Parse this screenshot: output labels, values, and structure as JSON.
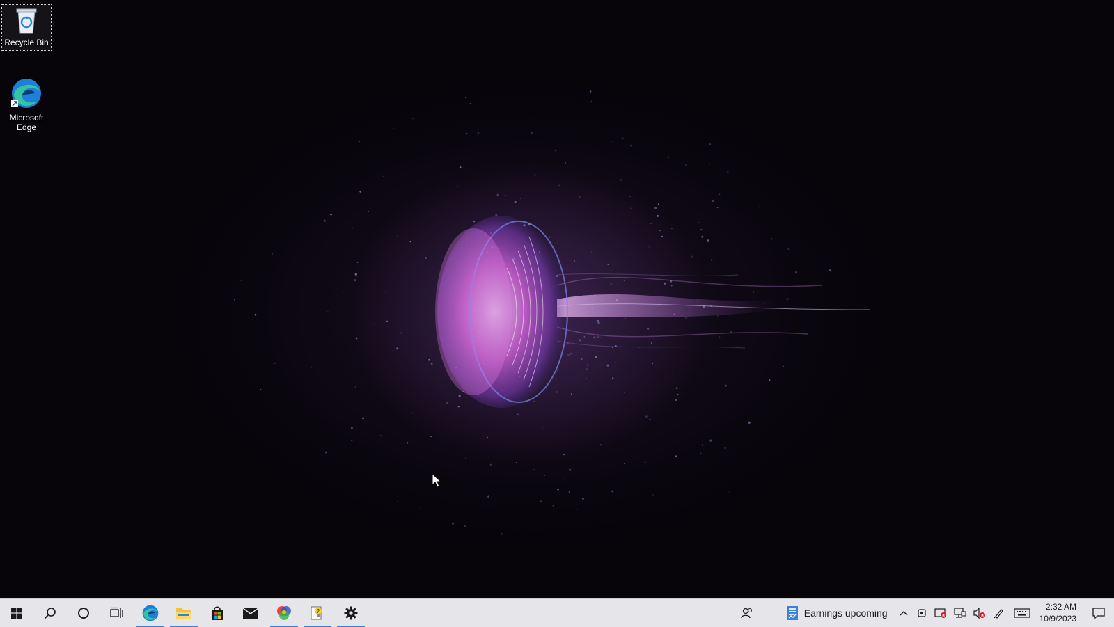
{
  "desktop": {
    "icons": [
      {
        "label": "Recycle Bin",
        "selected": true
      },
      {
        "label": "Microsoft Edge",
        "selected": false
      }
    ]
  },
  "taskbar": {
    "pinned": [
      {
        "name": "start",
        "icon": "windows-logo-icon",
        "running": false
      },
      {
        "name": "search",
        "icon": "search-icon",
        "running": false
      },
      {
        "name": "cortana",
        "icon": "cortana-circle-icon",
        "running": false
      },
      {
        "name": "task-view",
        "icon": "task-view-icon",
        "running": false
      },
      {
        "name": "edge",
        "icon": "edge-icon",
        "running": true
      },
      {
        "name": "file-explorer",
        "icon": "folder-icon",
        "running": true
      },
      {
        "name": "store",
        "icon": "store-icon",
        "running": false
      },
      {
        "name": "mail",
        "icon": "mail-icon",
        "running": false
      },
      {
        "name": "color-app",
        "icon": "color-wheel-icon",
        "running": true
      },
      {
        "name": "tips",
        "icon": "tips-lightbulb-icon",
        "running": true
      },
      {
        "name": "settings",
        "icon": "gear-icon",
        "running": true
      }
    ],
    "news_widget": {
      "text": "Earnings upcoming"
    },
    "clock": {
      "time": "2:32 AM",
      "date": "10/9/2023"
    }
  },
  "colors": {
    "taskbar_bg": "#e6e6ea",
    "running_indicator": "#3a7bd5",
    "wallpaper_pink": "#d46ad8",
    "wallpaper_blue": "#6a7cf0"
  }
}
